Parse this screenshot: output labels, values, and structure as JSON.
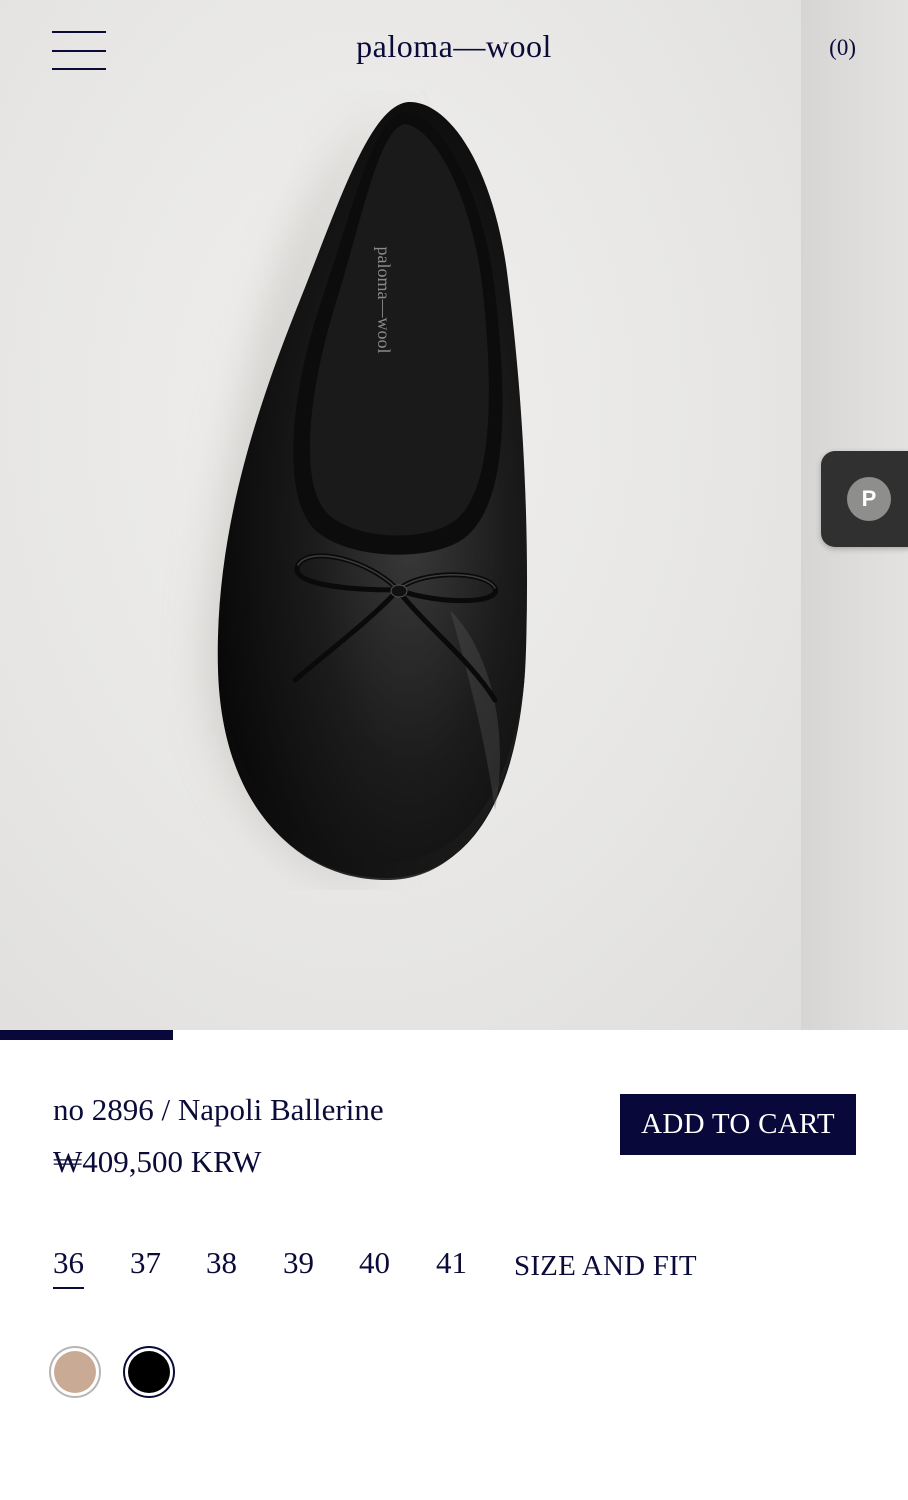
{
  "header": {
    "brand": "paloma—wool",
    "cart_count": "(0)",
    "menu_icon": "hamburger-menu-icon"
  },
  "hero": {
    "shoe_insole_logo": "paloma—wool",
    "active_slide_fraction": 0.19
  },
  "floating_widget": {
    "letter": "P"
  },
  "product": {
    "name": "no 2896 / Napoli Ballerine",
    "price": "₩409,500 KRW",
    "add_to_cart_label": "ADD TO CART"
  },
  "sizes": {
    "options": [
      "36",
      "37",
      "38",
      "39",
      "40",
      "41"
    ],
    "selected": "36",
    "size_and_fit_label": "SIZE AND FIT"
  },
  "colors": {
    "swatches": [
      {
        "name": "beige",
        "hex": "#c9ab95",
        "selected": false
      },
      {
        "name": "black",
        "hex": "#000000",
        "selected": true
      }
    ]
  },
  "theme": {
    "brand_navy": "#08083a",
    "hero_background": "#e9e8e6"
  }
}
